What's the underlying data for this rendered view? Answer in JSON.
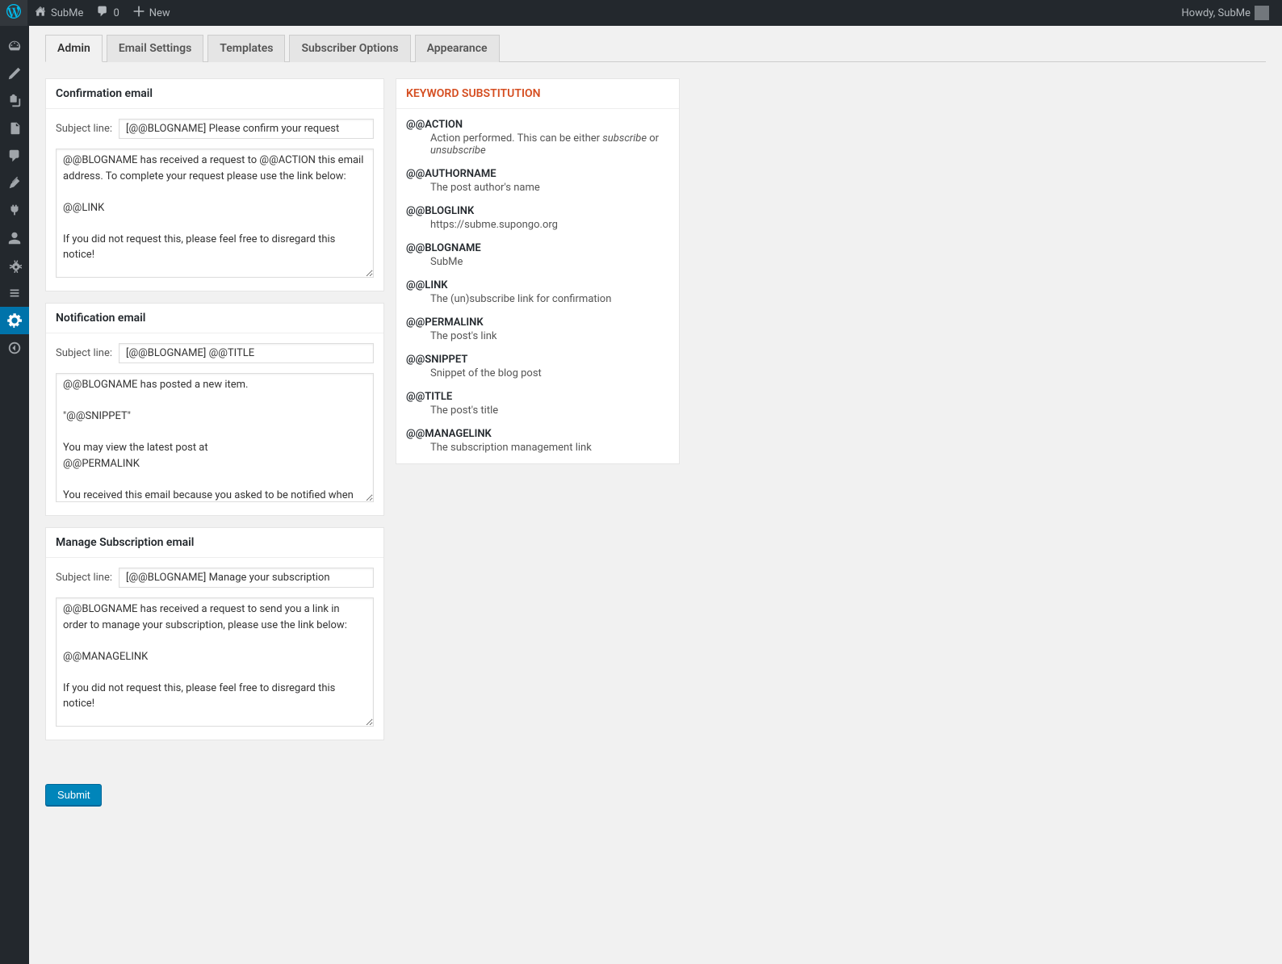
{
  "topbar": {
    "site_name": "SubMe",
    "comments_count": "0",
    "new_label": "New",
    "howdy": "Howdy, SubMe"
  },
  "tabs": [
    {
      "label": "Admin",
      "active": true
    },
    {
      "label": "Email Settings",
      "active": false
    },
    {
      "label": "Templates",
      "active": false
    },
    {
      "label": "Subscriber Options",
      "active": false
    },
    {
      "label": "Appearance",
      "active": false
    }
  ],
  "panels": {
    "confirmation": {
      "title": "Confirmation email",
      "subject_label": "Subject line:",
      "subject_value": "[@@BLOGNAME] Please confirm your request",
      "body_value": "@@BLOGNAME has received a request to @@ACTION this email address. To complete your request please use the link below:\n\n@@LINK\n\nIf you did not request this, please feel free to disregard this notice!\n\nBest regards,\n\n@@BLOGNAME"
    },
    "notification": {
      "title": "Notification email",
      "subject_label": "Subject line:",
      "subject_value": "[@@BLOGNAME] @@TITLE",
      "body_value": "@@BLOGNAME has posted a new item.\n\n\"@@SNIPPET\"\n\nYou may view the latest post at\n@@PERMALINK\n\nYou received this email because you asked to be notified when new posts are published."
    },
    "manage": {
      "title": "Manage Subscription email",
      "subject_label": "Subject line:",
      "subject_value": "[@@BLOGNAME] Manage your subscription",
      "body_value": "@@BLOGNAME has received a request to send you a link in order to manage your subscription, please use the link below:\n\n@@MANAGELINK\n\nIf you did not request this, please feel free to disregard this notice!\n\nBest regards,\n\n@@BLOGNAME"
    }
  },
  "keywords": {
    "title": "KEYWORD SUBSTITUTION",
    "items": [
      {
        "term": "@@ACTION",
        "desc_pre": "Action performed. This can be either ",
        "desc_em1": "subscribe",
        "desc_mid": " or ",
        "desc_em2": "unsubscribe",
        "has_em": true
      },
      {
        "term": "@@AUTHORNAME",
        "desc": "The post author's name"
      },
      {
        "term": "@@BLOGLINK",
        "desc": "https://subme.supongo.org"
      },
      {
        "term": "@@BLOGNAME",
        "desc": "SubMe"
      },
      {
        "term": "@@LINK",
        "desc": "The (un)subscribe link for confirmation"
      },
      {
        "term": "@@PERMALINK",
        "desc": "The post's link"
      },
      {
        "term": "@@SNIPPET",
        "desc": "Snippet of the blog post"
      },
      {
        "term": "@@TITLE",
        "desc": "The post's title"
      },
      {
        "term": "@@MANAGELINK",
        "desc": "The subscription management link"
      }
    ]
  },
  "submit_label": "Submit"
}
